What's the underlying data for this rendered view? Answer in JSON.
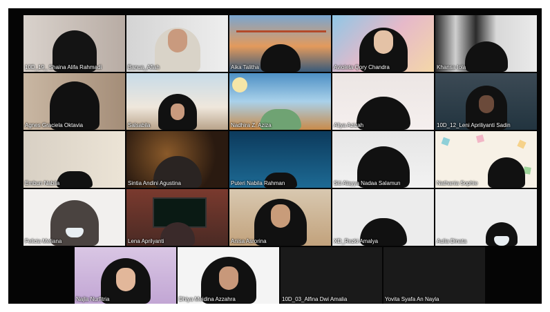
{
  "meeting": {
    "participants": [
      {
        "name": "10D_19_ Shaina Alifa Rahmadi"
      },
      {
        "name": "Banua_Afiah"
      },
      {
        "name": "Aika Talitha"
      },
      {
        "name": "Avioleta Qory Chandra"
      },
      {
        "name": "Khansa Iola"
      },
      {
        "name": "Agnes Graciela Oktavia"
      },
      {
        "name": "Salsabila"
      },
      {
        "name": "Nadhira Z. Aziza"
      },
      {
        "name": "Aliya Azizah"
      },
      {
        "name": "10D_12_Leni Apriliyanti Sadin"
      },
      {
        "name": "Embun Nabila"
      },
      {
        "name": "Sintia Andini Agustina"
      },
      {
        "name": "Puteri Nabila Rahman"
      },
      {
        "name": "Siti Alayya Nadaa Salamun"
      },
      {
        "name": "Nathania Sophie"
      },
      {
        "name": "Felicia Meliana"
      },
      {
        "name": "Lena Aprilyanti"
      },
      {
        "name": "Anisa Asrorina"
      },
      {
        "name": "XD_Rezki Amalya"
      },
      {
        "name": "Aulia Dinata"
      },
      {
        "name": "Najla Nurfitria"
      },
      {
        "name": "Dhiya Meidina Azzahra"
      },
      {
        "name": "10D_03_Alfina Dwi Amalia"
      },
      {
        "name": "Yovita Syafa An Nayla"
      }
    ]
  }
}
